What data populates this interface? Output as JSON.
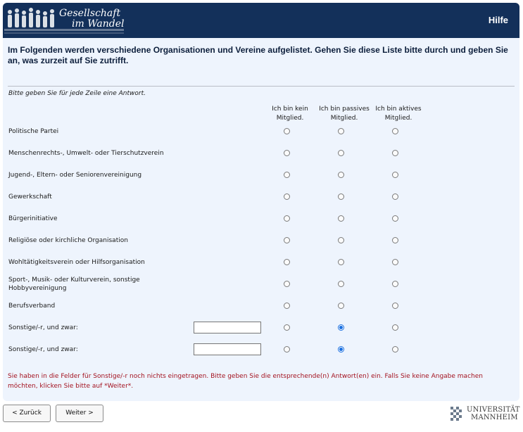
{
  "header": {
    "logo_line1": "Gesellschaft",
    "logo_line2": "im Wandel",
    "help_label": "Hilfe"
  },
  "question": "Im Folgenden werden verschiedene Organisationen und Vereine aufgelistet. Gehen Sie diese Liste bitte durch und geben Sie an, was zurzeit auf Sie zutrifft.",
  "instruction": "Bitte geben Sie für jede Zeile eine Antwort.",
  "columns": [
    {
      "line1": "Ich bin kein",
      "line2": "Mitglied."
    },
    {
      "line1": "Ich bin passives",
      "line2": "Mitglied."
    },
    {
      "line1": "Ich bin aktives",
      "line2": "Mitglied."
    }
  ],
  "rows": [
    {
      "label": "Politische Partei",
      "selected": null
    },
    {
      "label": "Menschenrechts-, Umwelt- oder Tierschutzverein",
      "selected": null
    },
    {
      "label": "Jugend-, Eltern- oder Seniorenvereinigung",
      "selected": null
    },
    {
      "label": "Gewerkschaft",
      "selected": null
    },
    {
      "label": "Bürgerinitiative",
      "selected": null
    },
    {
      "label": "Religiöse oder kirchliche Organisation",
      "selected": null
    },
    {
      "label": "Wohltätigkeitsverein oder Hilfsorganisation",
      "selected": null
    },
    {
      "label": "Sport-, Musik- oder Kulturverein, sonstige Hobbyvereinigung",
      "selected": null
    },
    {
      "label": "Berufsverband",
      "selected": null
    },
    {
      "label": "Sonstige/-r, und zwar:",
      "selected": 1,
      "text_value": ""
    },
    {
      "label": "Sonstige/-r, und zwar:",
      "selected": 1,
      "text_value": ""
    }
  ],
  "error_message": "Sie haben in die Felder für Sonstige/-r noch nichts eingetragen. Bitte geben Sie die entsprechende(n) Antwort(en) ein. Falls Sie keine Angabe machen möchten, klicken Sie bitte auf *Weiter*.",
  "nav": {
    "back_label": "< Zurück",
    "next_label": "Weiter >"
  },
  "university": {
    "line1": "UNIVERSITÄT",
    "line2": "MANNHEIM"
  },
  "colors": {
    "header_bg": "#13305a",
    "panel_bg": "#eef4fd",
    "error_text": "#a3121f",
    "radio_selected": "#1a6fe0"
  }
}
